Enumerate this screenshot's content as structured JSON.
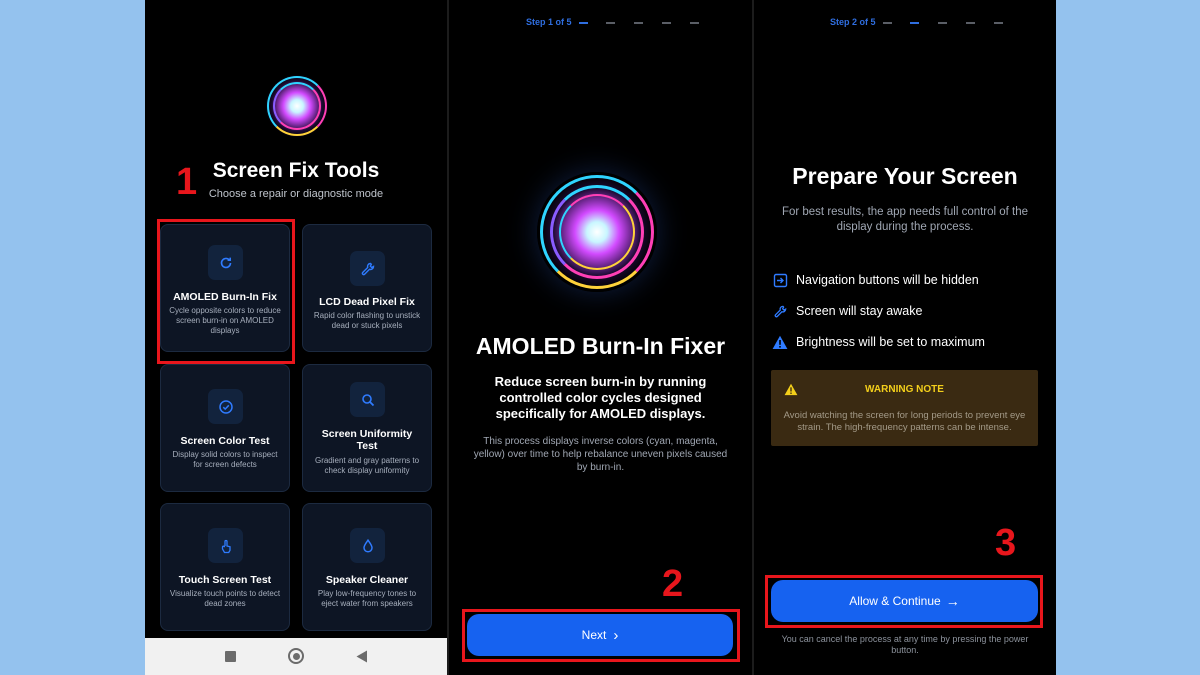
{
  "colors": {
    "accent": "#1662f0",
    "highlight": "#e8161c",
    "background": "#94c2ee",
    "warning": "#f3cf1b"
  },
  "annotations": [
    "1",
    "2",
    "3"
  ],
  "tools_screen": {
    "title": "Screen Fix Tools",
    "subtitle": "Choose a repair or diagnostic mode",
    "cards": [
      {
        "icon": "refresh-icon",
        "title": "AMOLED Burn-In Fix",
        "desc": "Cycle opposite colors to reduce screen burn-in on AMOLED displays"
      },
      {
        "icon": "wrench-icon",
        "title": "LCD Dead Pixel Fix",
        "desc": "Rapid color flashing to unstick dead or stuck pixels"
      },
      {
        "icon": "check-circle-icon",
        "title": "Screen Color Test",
        "desc": "Display solid colors to inspect for screen defects"
      },
      {
        "icon": "search-icon",
        "title": "Screen Uniformity Test",
        "desc": "Gradient and gray patterns to check display uniformity"
      },
      {
        "icon": "touch-icon",
        "title": "Touch Screen Test",
        "desc": "Visualize touch points to detect dead zones"
      },
      {
        "icon": "water-drop-icon",
        "title": "Speaker Cleaner",
        "desc": "Play low-frequency tones to eject water from speakers"
      }
    ],
    "nav": {
      "recents": "square-icon",
      "home": "circle-icon",
      "back": "triangle-back-icon"
    }
  },
  "intro_screen": {
    "step": "Step 1 of 5",
    "title": "AMOLED Burn-In Fixer",
    "lead": "Reduce screen burn-in by running controlled color cycles designed specifically for AMOLED displays.",
    "desc": "This process displays inverse colors (cyan, magenta, yellow) over time to help rebalance uneven pixels caused by burn-in.",
    "button": "Next",
    "button_icon": "›"
  },
  "prepare_screen": {
    "step": "Step 2 of 5",
    "title": "Prepare Your Screen",
    "subtitle": "For best results, the app needs full control of the display during the process.",
    "items": [
      {
        "icon": "exit-icon",
        "text": "Navigation buttons will be hidden"
      },
      {
        "icon": "wrench-icon",
        "text": "Screen will stay awake"
      },
      {
        "icon": "warning-icon",
        "text": "Brightness will be set to maximum"
      }
    ],
    "warning_title": "WARNING NOTE",
    "warning_text": "Avoid watching the screen for long periods to prevent eye strain. The high-frequency patterns can be intense.",
    "button": "Allow & Continue",
    "button_icon": "→",
    "footer": "You can cancel the process at any time by pressing the power button."
  }
}
